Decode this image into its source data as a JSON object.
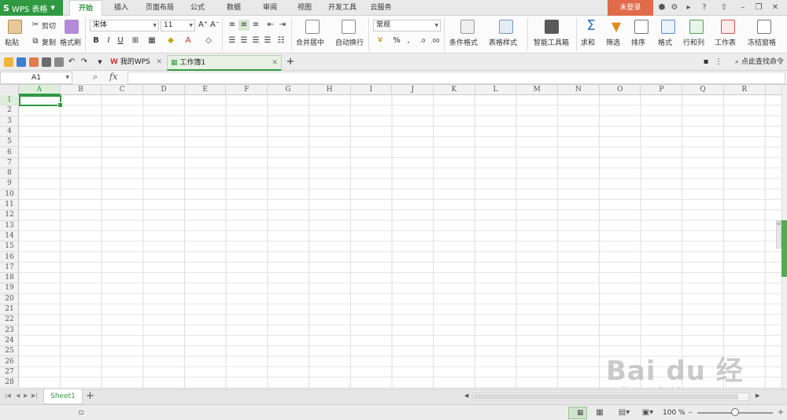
{
  "app": {
    "name": "WPS 表格",
    "logo": "S"
  },
  "menu": {
    "tabs": [
      "开始",
      "插入",
      "页面布局",
      "公式",
      "数据",
      "审阅",
      "视图",
      "开发工具",
      "云服务"
    ],
    "active": "开始",
    "login": "未登录"
  },
  "ribbon": {
    "paste": "粘贴",
    "cut": "剪切",
    "copy": "复制",
    "format_painter": "格式刷",
    "font_name": "宋体",
    "font_size": "11",
    "bold": "B",
    "italic": "I",
    "underline": "U",
    "merge_center": "合并居中",
    "wrap_text": "自动换行",
    "number_format": "常规",
    "percent": "%",
    "comma": ",",
    "conditional_format": "条件格式",
    "table_style": "表格样式",
    "smart_toolbox": "智能工具箱",
    "sum": "求和",
    "filter": "筛选",
    "sort": "排序",
    "format": "格式",
    "rows_cols": "行和列",
    "worksheet": "工作表",
    "freeze": "冻结窗格"
  },
  "doc_tabs": {
    "my_wps": "我的WPS",
    "workbook": "工作簿1",
    "search_cmd": "点此查找命令"
  },
  "formula_bar": {
    "cell_ref": "A1",
    "fx": "fx"
  },
  "grid": {
    "columns": [
      "A",
      "B",
      "C",
      "D",
      "E",
      "F",
      "G",
      "H",
      "I",
      "J",
      "K",
      "L",
      "M",
      "N",
      "O",
      "P",
      "Q",
      "R"
    ],
    "rows": [
      "1",
      "2",
      "3",
      "4",
      "5",
      "6",
      "7",
      "8",
      "9",
      "10",
      "11",
      "12",
      "13",
      "14",
      "15",
      "16",
      "17",
      "18",
      "19",
      "20",
      "21",
      "22",
      "23",
      "24",
      "25",
      "26",
      "27",
      "28"
    ],
    "active_cell": "A1"
  },
  "sheets": {
    "tabs": [
      "Sheet1"
    ],
    "add": "+"
  },
  "status": {
    "zoom": "100 %",
    "zoom_level": 1.0
  },
  "watermark": {
    "text": "Bai du 经验",
    "url": "jingyan.baidu.com"
  },
  "colors": {
    "accent": "#2f9a41",
    "login": "#e06a4a",
    "scroll_thumb": "#4caf50"
  }
}
